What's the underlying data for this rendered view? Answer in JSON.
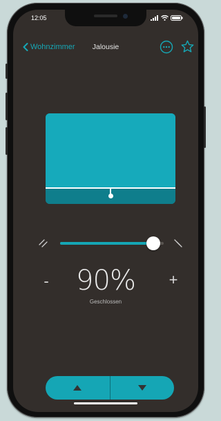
{
  "status": {
    "time": "12:05"
  },
  "nav": {
    "back_label": "Wohnzimmer",
    "title": "Jalousie"
  },
  "blind": {
    "closed_fraction": 0.9
  },
  "position": {
    "value": "90%",
    "state": "Geschlossen",
    "minus_label": "-",
    "plus_label": "+"
  },
  "colors": {
    "accent": "#15a6b5",
    "background": "#332e2b",
    "blind_covered": "#16aabb",
    "blind_lower": "#0f7e8c"
  },
  "icons": {
    "back": "chevron-left-icon",
    "more": "more-circle-icon",
    "favorite": "star-icon",
    "open": "slider-open-icon",
    "close": "slider-close-icon",
    "up": "arrow-up-icon",
    "down": "arrow-down-icon"
  }
}
